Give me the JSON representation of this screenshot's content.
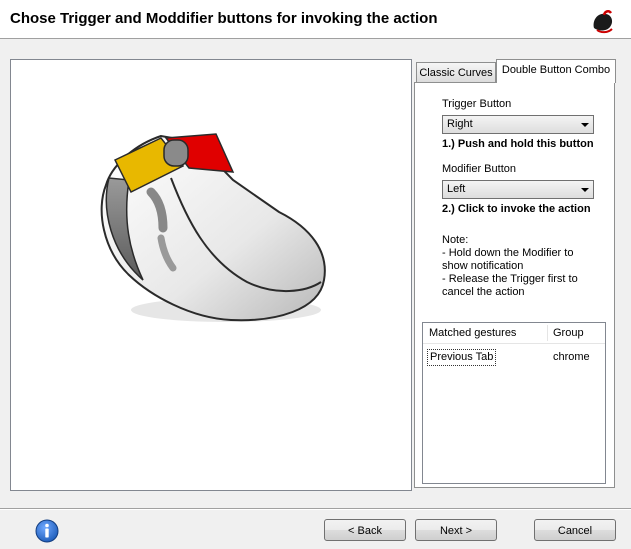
{
  "header": {
    "title": "Chose Trigger and Moddifier buttons for invoking the action"
  },
  "tabs": {
    "classic_label": "Classic Curves",
    "double_label": "Double Button Combo"
  },
  "panel": {
    "trigger_label": "Trigger Button",
    "trigger_value": "Right",
    "trigger_hint": "1.) Push and hold this button",
    "modifier_label": "Modifier Button",
    "modifier_value": "Left",
    "modifier_hint": "2.) Click to invoke the action",
    "note_lines": [
      "Note:",
      "- Hold down the Modifier to",
      "show notification",
      "- Release the Trigger first to",
      "cancel the action"
    ]
  },
  "gestures": {
    "columns": [
      "Matched gestures",
      "Group"
    ],
    "rows": [
      {
        "gesture": "Previous Tab",
        "group": "chrome"
      }
    ]
  },
  "footer": {
    "back_label": "< Back",
    "next_label": "Next >",
    "cancel_label": "Cancel"
  },
  "colors": {
    "trigger_button": "#e00000",
    "modifier_button": "#e8b800",
    "info_icon": "#1c5bb8"
  }
}
